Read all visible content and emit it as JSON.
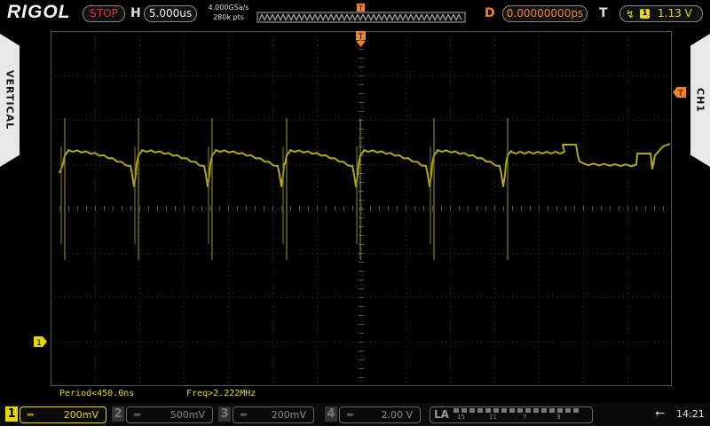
{
  "header": {
    "brand": "RIGOL",
    "run_state": "STOP",
    "horizontal_label": "H",
    "timebase": "5.000us",
    "sample_rate": "4.000GSa/s",
    "memory_depth": "280k pts",
    "delay_label": "D",
    "delay_value": "0.00000000ps",
    "trigger_label": "T",
    "trigger_source": "1",
    "trigger_level": "1.13 V"
  },
  "side_tabs": {
    "left": "VERTICAL",
    "right": "CH1"
  },
  "markers": {
    "trigger_position": "T",
    "trigger_level_marker": "T",
    "channel1_ground": "1"
  },
  "measurements": {
    "period": "Period<450.0ns",
    "freq": "Freq>2.222MHz"
  },
  "channels": [
    {
      "num": "1",
      "scale": "200mV",
      "active": true
    },
    {
      "num": "2",
      "scale": "500mV",
      "active": false
    },
    {
      "num": "3",
      "scale": "200mV",
      "active": false
    },
    {
      "num": "4",
      "scale": "2.00 V",
      "active": false
    }
  ],
  "la": {
    "label": "LA",
    "groups": [
      "15",
      "11",
      "7",
      "3"
    ]
  },
  "status": {
    "time": "14:21"
  },
  "colors": {
    "ch1": "#e6d800",
    "trace": "#b0a818",
    "trigger": "#f58220",
    "stop": "#e03030"
  }
}
